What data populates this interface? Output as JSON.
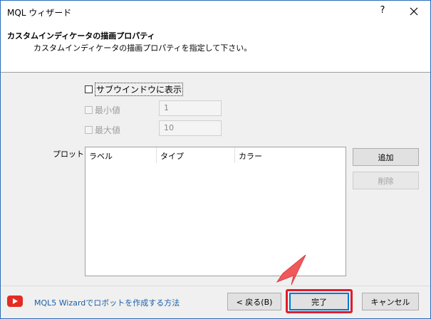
{
  "window": {
    "title": "MQL ウィザード",
    "help_label": "?"
  },
  "header": {
    "title": "カスタムインディケータの描画プロパティ",
    "subtitle": "カスタムインディケータの描画プロパティを指定して下さい。"
  },
  "options": {
    "subwindow_label": "サブウインドウに表示",
    "min_label": "最小値",
    "min_value": "1",
    "max_label": "最大値",
    "max_value": "10"
  },
  "plots": {
    "label": "プロット:",
    "columns": [
      "ラベル",
      "タイプ",
      "カラー"
    ],
    "add_label": "追加",
    "delete_label": "削除"
  },
  "footer": {
    "link_text": "MQL5 Wizardでロボットを作成する方法",
    "back_label": "< 戻る(B)",
    "finish_label": "完了",
    "cancel_label": "キャンセル"
  },
  "colors": {
    "accent": "#0078d7",
    "highlight": "#e11d2a",
    "arrow": "#f0585a",
    "youtube": "#e42b24",
    "link": "#1a5fa8"
  }
}
